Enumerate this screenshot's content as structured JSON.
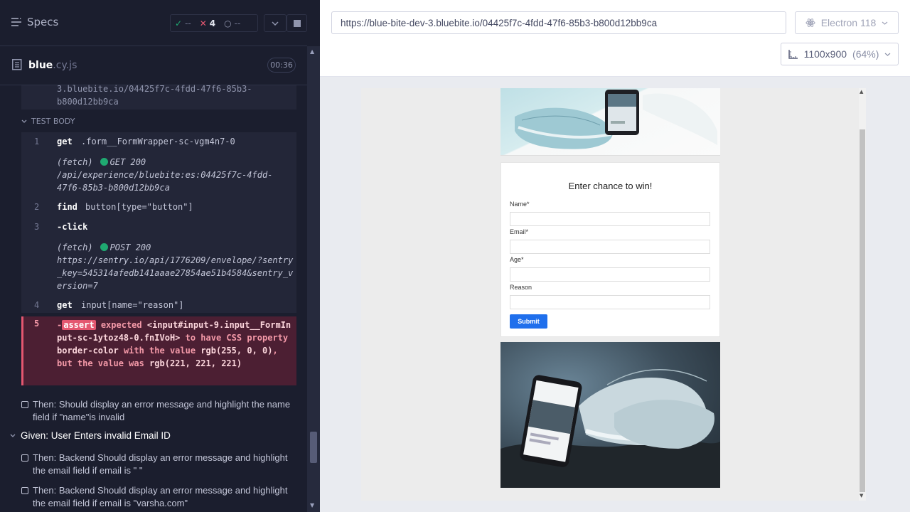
{
  "reporter": {
    "specs_label": "Specs",
    "stats": {
      "passed": "--",
      "failed": "4",
      "pending": "--"
    },
    "file": {
      "name": "blue",
      "ext": ".cy.js",
      "duration": "00:36"
    },
    "prev_url": [
      "3.bluebite.io/04425f7c-4fdd-47f6-85b3-",
      "b800d12bb9ca"
    ],
    "test_body_label": "TEST BODY",
    "commands": [
      {
        "num": "1",
        "name": "get",
        "arg": ".form__FormWrapper-sc-vgm4n7-0"
      },
      {
        "num": "2",
        "name": "find",
        "arg": "button[type=\"button\"]"
      },
      {
        "num": "3",
        "name": "-click",
        "arg": ""
      },
      {
        "num": "4",
        "name": "get",
        "arg": "input[name=\"reason\"]"
      }
    ],
    "fetch1": {
      "prefix": "(fetch)",
      "method": "GET 200",
      "url": "/api/experience/bluebite:es:04425f7c-4fdd-47f6-85b3-b800d12bb9ca"
    },
    "fetch2": {
      "prefix": "(fetch)",
      "method": "POST 200",
      "url": "https://sentry.io/api/1776209/envelope/?sentry_key=545314afedb141aaae27854ae51b4584&sentry_version=7"
    },
    "failed": {
      "num": "5",
      "dash": "-",
      "tag": "assert",
      "t1": "expected",
      "el": "<input#input-9.input__FormInput-sc-1ytoz48-0.fnIVoH>",
      "t2": "to have CSS property",
      "prop": "border-color",
      "t3": "with the value",
      "v1": "rgb(255, 0, 0)",
      "t4": ", but the value was",
      "v2": "rgb(221, 221, 221)"
    },
    "tests": [
      "Then: Should display an error message and highlight the name field if \"name\"is invalid",
      "Then: Backend Should display an error message and highlight the email field if email is \" \"",
      "Then: Backend Should display an error message and highlight the email field if email is \"varsha.com\""
    ],
    "given": "Given: User Enters invalid Email ID"
  },
  "aut": {
    "url": "https://blue-bite-dev-3.bluebite.io/04425f7c-4fdd-47f6-85b3-b800d12bb9ca",
    "browser": "Electron 118",
    "viewport": "1100x900",
    "scale": "(64%)",
    "form": {
      "title": "Enter chance to win!",
      "labels": [
        "Name*",
        "Email*",
        "Age*",
        "Reason"
      ],
      "submit": "Submit"
    }
  },
  "colors": {
    "fail": "#e45770",
    "pass": "#1fa971",
    "submit": "#1f6fec"
  }
}
